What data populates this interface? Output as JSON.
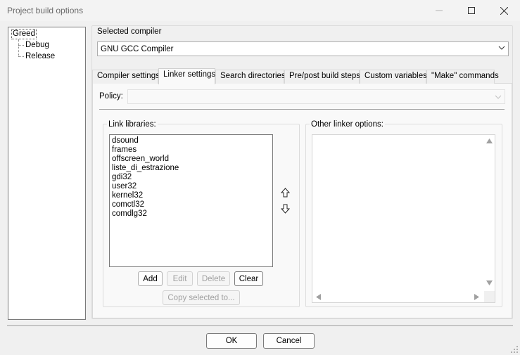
{
  "window": {
    "title": "Project build options",
    "controls": [
      "minimize-icon",
      "maximize-icon",
      "close-icon"
    ]
  },
  "tree": {
    "root": "Greed",
    "children": [
      "Debug",
      "Release"
    ]
  },
  "compiler": {
    "label": "Selected compiler",
    "value": "GNU GCC Compiler"
  },
  "tabs": [
    {
      "label": "Compiler settings",
      "active": false
    },
    {
      "label": "Linker settings",
      "active": true
    },
    {
      "label": "Search directories",
      "active": false
    },
    {
      "label": "Pre/post build steps",
      "active": false
    },
    {
      "label": "Custom variables",
      "active": false
    },
    {
      "label": "\"Make\" commands",
      "active": false
    }
  ],
  "linker": {
    "policy_label": "Policy:",
    "policy_value": "",
    "link_libraries_label": "Link libraries:",
    "libraries": [
      "dsound",
      "frames",
      "offscreen_world",
      "liste_di_estrazione",
      "gdi32",
      "user32",
      "kernel32",
      "comctl32",
      "comdlg32"
    ],
    "move_up_icon": "arrow-up-outline-icon",
    "move_down_icon": "arrow-down-outline-icon",
    "buttons": {
      "add": "Add",
      "edit": "Edit",
      "delete": "Delete",
      "clear": "Clear",
      "copy": "Copy selected to..."
    },
    "other_options_label": "Other linker options:",
    "other_options_value": ""
  },
  "footer": {
    "ok": "OK",
    "cancel": "Cancel"
  }
}
